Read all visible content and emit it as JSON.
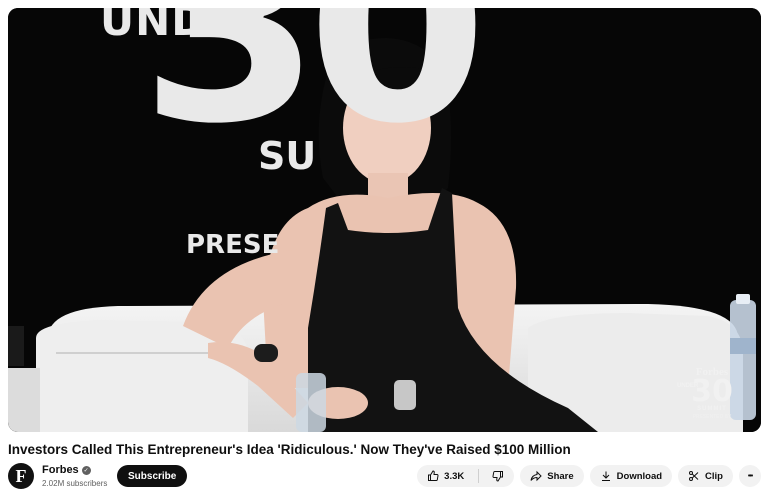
{
  "video": {
    "backdrop_under": "UNDER",
    "backdrop_30": "30",
    "backdrop_summit": "SU",
    "backdrop_presented": "PRESE",
    "watermark": {
      "brand": "Forbes",
      "under": "UNDER",
      "number": "30",
      "summit": "SUMMIT",
      "small": "PRESENTED BY"
    }
  },
  "title": "Investors Called This Entrepreneur's Idea 'Ridiculous.' Now They've Raised $100 Million",
  "channel": {
    "avatar_letter": "F",
    "name": "Forbes",
    "verified_glyph": "✓",
    "subscribers": "2.02M subscribers",
    "subscribe_label": "Subscribe"
  },
  "actions": {
    "likes": "3.3K",
    "share_label": "Share",
    "download_label": "Download",
    "clip_label": "Clip",
    "more_glyph": "•••"
  },
  "icons": [
    "thumbs-up-icon",
    "thumbs-down-icon",
    "share-icon",
    "download-icon",
    "scissors-icon",
    "more-icon",
    "verified-icon"
  ]
}
